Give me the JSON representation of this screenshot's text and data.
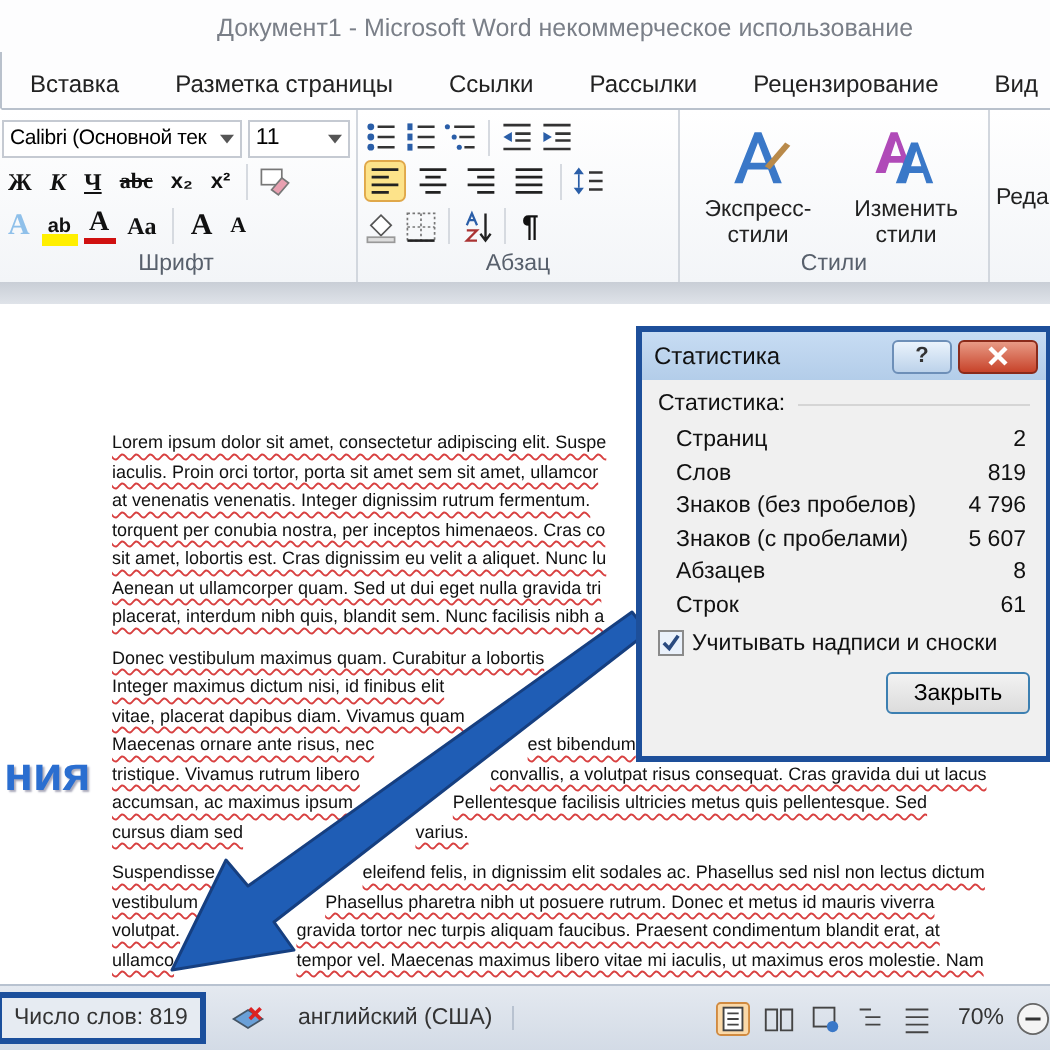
{
  "window": {
    "title": "Документ1 - Microsoft Word некоммерческое использование"
  },
  "tabs": [
    {
      "selected": true
    },
    {
      "label": "Вставка",
      "selected": false
    },
    {
      "label": "Разметка страницы",
      "selected": false
    },
    {
      "label": "Ссылки",
      "selected": false
    },
    {
      "label": "Рассылки",
      "selected": false
    },
    {
      "label": "Рецензирование",
      "selected": false
    },
    {
      "label": "Вид",
      "selected": false
    }
  ],
  "ribbon": {
    "font": {
      "label": "Шрифт",
      "font_name": "Calibri (Основной тек",
      "font_size": "11",
      "format_buttons": [
        "Ж",
        "К",
        "Ч",
        "abc",
        "x₂",
        "x²"
      ],
      "effect_buttons": [
        "A",
        "ab",
        "A",
        "Aa"
      ],
      "size_buttons": [
        "A",
        "A"
      ]
    },
    "paragraph": {
      "label": "Абзац",
      "alignments": [
        {
          "kind": "left",
          "selected": true
        },
        {
          "kind": "center",
          "selected": false
        },
        {
          "kind": "right",
          "selected": false
        },
        {
          "kind": "justify",
          "selected": false
        }
      ],
      "pilcrow": "¶"
    },
    "styles": {
      "label": "Стили",
      "buttons": [
        "Экспресс-стили",
        "Изменить стили"
      ]
    },
    "editing": {
      "label": "Реда"
    }
  },
  "document": {
    "side_heading": "ния",
    "paragraphs": [
      [
        [
          "Lorem ipsum dolor sit amet, consectetur adipiscing elit. Suspe"
        ],
        [
          "iaculis. Proin orci tortor, porta sit amet sem sit amet, ullamcor"
        ],
        [
          "at venenatis venenatis. Integer dignissim rutrum fermentum."
        ],
        [
          "torquent per conubia nostra, per inceptos himenaeos. Cras co"
        ],
        [
          "sit amet, lobortis est. Cras dignissim eu velit a aliquet. Nunc lu"
        ],
        [
          "Aenean ut ullamcorper quam. Sed ut dui eget nulla gravida tri"
        ],
        [
          "placerat, interdum nibh quis, blandit sem. Nunc facilisis nibh a"
        ]
      ],
      [
        [
          "Donec vestibulum maximus quam. Curabitur a lobortis"
        ],
        [
          "Integer maximus dictum nisi, id finibus elit"
        ],
        [
          "vitae, placerat dapibus diam. Vivamus quam"
        ],
        [
          "Maecenas ornare ante risus, nec",
          "est bibendum"
        ],
        [
          "tristique. Vivamus rutrum libero",
          "convallis, a volutpat risus consequat. Cras gravida dui ut lacus"
        ],
        [
          "accumsan, ac maximus ipsum",
          "Pellentesque facilisis ultricies metus quis pellentesque. Sed"
        ],
        [
          "cursus diam sed",
          "varius."
        ]
      ],
      [
        [
          "Suspendisse",
          "eleifend felis, in dignissim elit sodales ac. Phasellus sed nisl non lectus dictum"
        ],
        [
          "vestibulum",
          "Phasellus pharetra nibh ut posuere rutrum. Donec et metus id mauris viverra"
        ],
        [
          "volutpat.",
          "gravida tortor nec turpis aliquam faucibus. Praesent condimentum blandit erat, at"
        ],
        [
          "ullamco",
          "tempor vel. Maecenas maximus libero vitae mi iaculis, ut maximus eros molestie. Nam"
        ]
      ]
    ]
  },
  "dialog": {
    "title": "Статистика",
    "help": "?",
    "section": "Статистика:",
    "rows": [
      {
        "label": "Страниц",
        "value": "2"
      },
      {
        "label": "Слов",
        "value": "819"
      },
      {
        "label": "Знаков (без пробелов)",
        "value": "4 796"
      },
      {
        "label": "Знаков (с пробелами)",
        "value": "5 607"
      },
      {
        "label": "Абзацев",
        "value": "8"
      },
      {
        "label": "Строк",
        "value": "61"
      }
    ],
    "checkbox": {
      "label": "Учитывать надписи и сноски",
      "checked": true
    },
    "button": "Закрыть"
  },
  "status_bar": {
    "word_count": "Число слов: 819",
    "language": "английский (США)",
    "views": [
      {
        "selected": true
      },
      {
        "selected": false
      },
      {
        "selected": false
      },
      {
        "selected": false
      },
      {
        "selected": false
      }
    ],
    "zoom": "70%"
  }
}
